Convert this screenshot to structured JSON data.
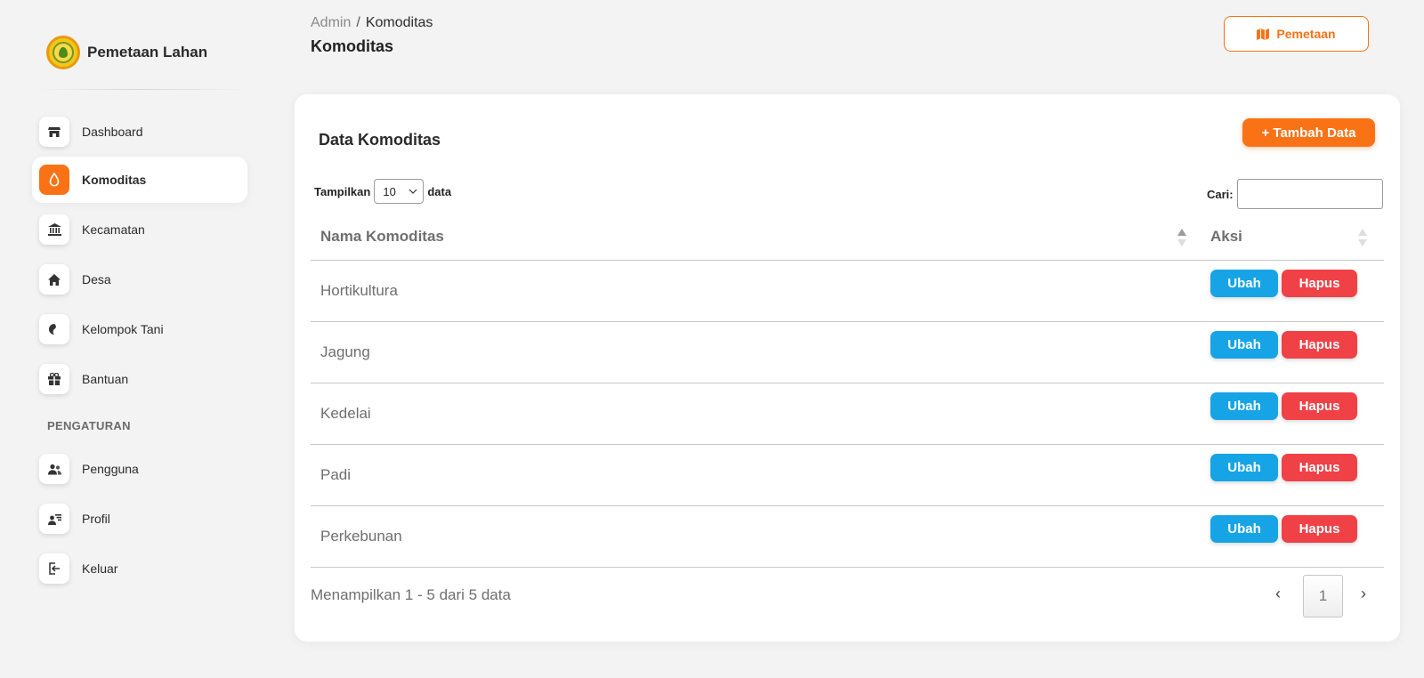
{
  "brand": {
    "name": "Pemetaan Lahan",
    "logo_icon": "agri-emblem-icon"
  },
  "sidebar": {
    "items": [
      {
        "label": "Dashboard",
        "icon": "store-icon",
        "active": false
      },
      {
        "label": "Komoditas",
        "icon": "droplet-icon",
        "active": true
      },
      {
        "label": "Kecamatan",
        "icon": "institution-icon",
        "active": false
      },
      {
        "label": "Desa",
        "icon": "home-icon",
        "active": false
      },
      {
        "label": "Kelompok Tani",
        "icon": "seed-icon",
        "active": false
      },
      {
        "label": "Bantuan",
        "icon": "gift-icon",
        "active": false
      }
    ],
    "section_label": "PENGATURAN",
    "settings_items": [
      {
        "label": "Pengguna",
        "icon": "users-icon"
      },
      {
        "label": "Profil",
        "icon": "profile-icon"
      },
      {
        "label": "Keluar",
        "icon": "logout-icon"
      }
    ]
  },
  "header": {
    "breadcrumb_root": "Admin",
    "breadcrumb_sep": "/",
    "breadcrumb_current": "Komoditas",
    "title": "Komoditas",
    "map_button": "Pemetaan"
  },
  "card": {
    "title": "Data Komoditas",
    "add_button": "+ Tambah Data",
    "length_prefix": "Tampilkan",
    "length_value": "10",
    "length_suffix": "data",
    "search_label": "Cari:",
    "search_value": ""
  },
  "table": {
    "columns": [
      "Nama Komoditas",
      "Aksi"
    ],
    "rows": [
      {
        "name": "Hortikultura"
      },
      {
        "name": "Jagung"
      },
      {
        "name": "Kedelai"
      },
      {
        "name": "Padi"
      },
      {
        "name": "Perkebunan"
      }
    ],
    "edit_label": "Ubah",
    "delete_label": "Hapus"
  },
  "footer": {
    "info": "Menampilkan 1 - 5 dari 5 data",
    "prev": "‹",
    "page": "1",
    "next": "›"
  },
  "colors": {
    "accent": "#f97316",
    "edit": "#16a4e6",
    "delete": "#ef4146"
  }
}
